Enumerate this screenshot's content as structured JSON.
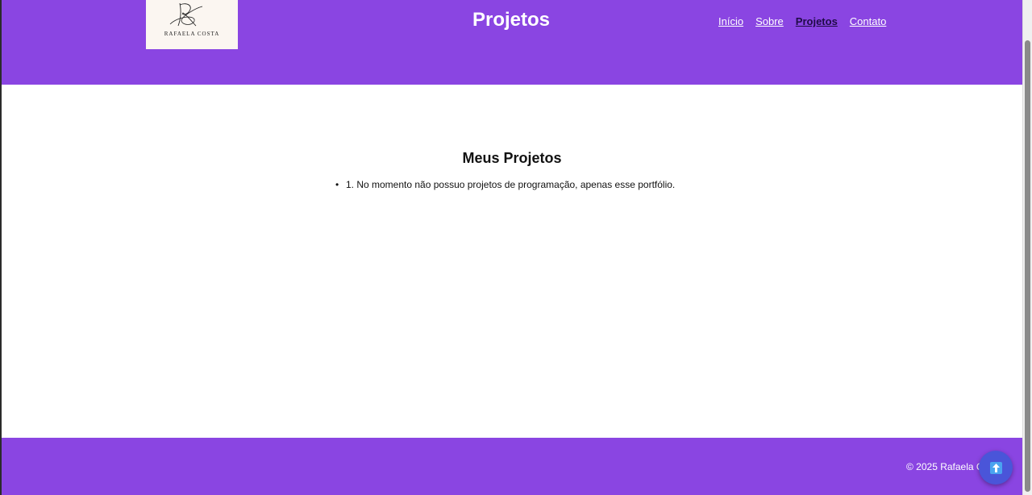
{
  "header": {
    "logo_text": "RAFAELA COSTA",
    "title": "Projetos",
    "nav": [
      {
        "label": "Início"
      },
      {
        "label": "Sobre"
      },
      {
        "label": "Projetos"
      },
      {
        "label": "Contato"
      }
    ],
    "active_nav": "Projetos",
    "background_color": "#8a45e2"
  },
  "main": {
    "section_title": "Meus Projetos",
    "projects": [
      {
        "bullet": "•",
        "text": "1. No momento não possuo projetos de programação, apenas esse portfólio."
      }
    ]
  },
  "footer": {
    "copyright": "© 2025 Rafaela C",
    "background_color": "#8a45e2"
  },
  "back_to_top": {
    "icon": "arrow-up-icon",
    "color": "#4a55d9"
  }
}
